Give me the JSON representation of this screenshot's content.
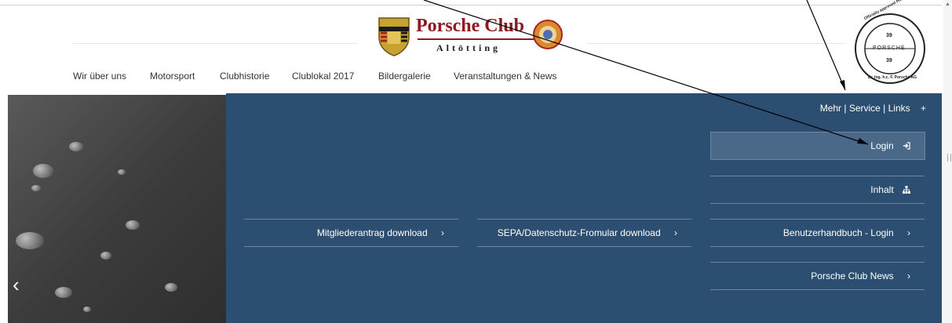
{
  "header": {
    "logo_title": "Porsche Club",
    "logo_subtitle": "Altötting",
    "seal": {
      "top_text": "Officially approved Porsche Club",
      "number": "39",
      "brand": "PORSCHE",
      "bottom_text": "Dr. Ing. h.c. F. Porsche AG"
    }
  },
  "nav": {
    "items": [
      "Wir über uns",
      "Motorsport",
      "Clubhistorie",
      "Clublokal 2017",
      "Bildergalerie",
      "Veranstaltungen & News"
    ]
  },
  "panel": {
    "mehr_label": "Mehr | Service | Links",
    "mehr_icon": "+",
    "login_label": "Login",
    "inhalt_label": "Inhalt",
    "links": {
      "mitglied": "Mitgliederantrag download",
      "sepa": "SEPA/Datenschutz-Fromular download",
      "handbuch": "Benutzerhandbuch - Login",
      "news": "Porsche Club News"
    },
    "chevron": "›"
  },
  "hero": {
    "prev_arrow": "‹"
  },
  "colors": {
    "panel": "#2c4e70",
    "active_row": "#4a6888",
    "brand_red": "#8e1a20"
  }
}
